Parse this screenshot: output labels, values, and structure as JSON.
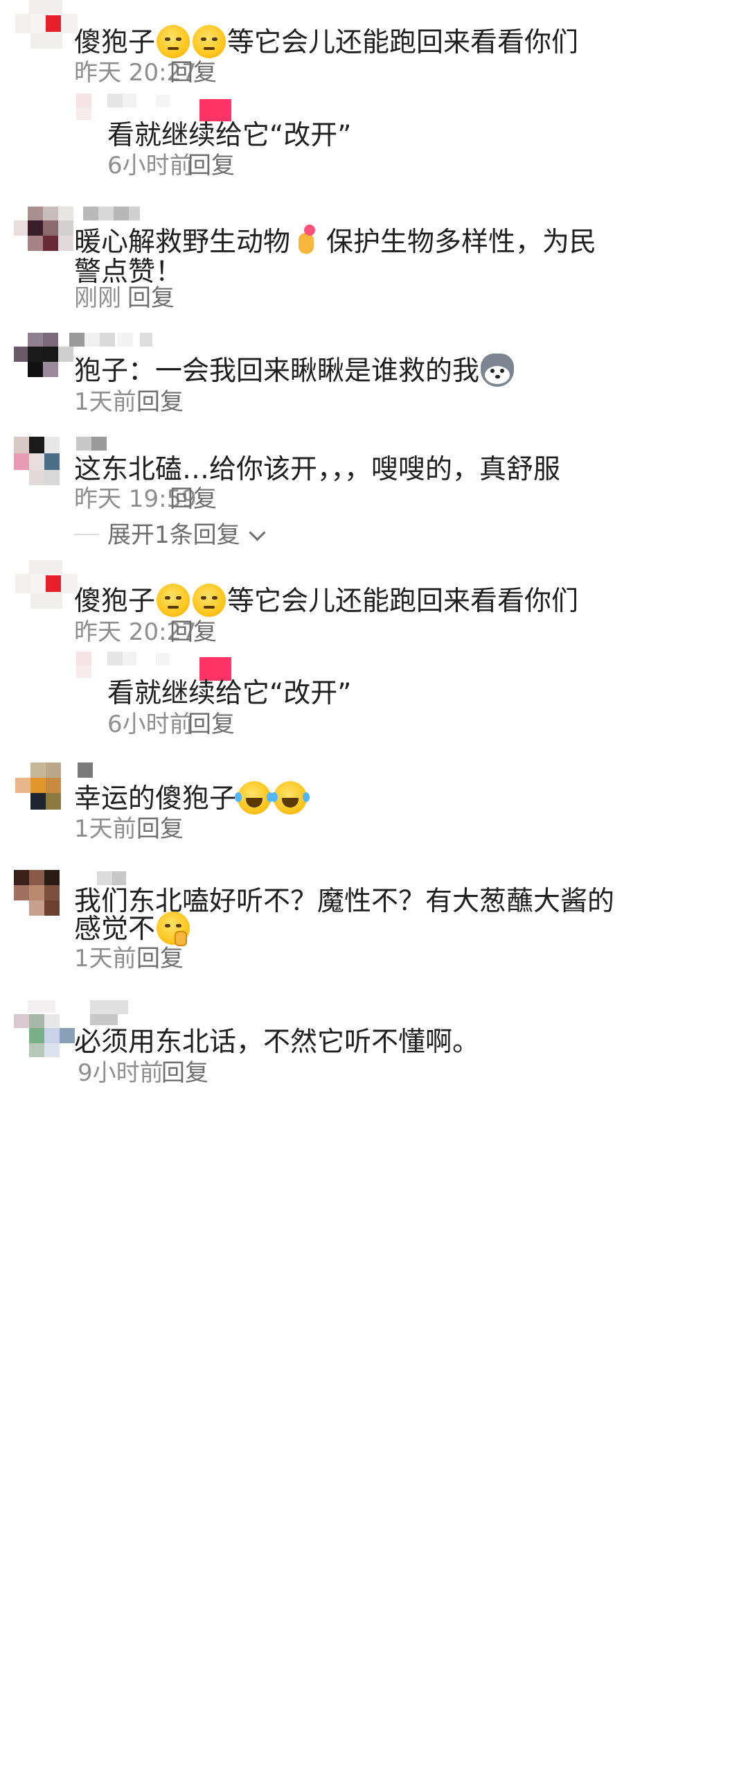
{
  "comments": [
    {
      "text_before": "傻狍子",
      "emojis": [
        "smirk-face-icon",
        "smirk-face-icon"
      ],
      "text_after": "等它会儿还能跑回来看看你们",
      "time": "昨天 20:27",
      "reply": "回复"
    },
    {
      "reply_text": "看就继续给它“改开”",
      "time": "6小时前",
      "reply": "回复"
    },
    {
      "text_line1_before": "暖心解救野生动物",
      "emoji": "heart-hand-icon",
      "text_line1_after": "保护生物多样性，为民",
      "text_line2": "警点赞！",
      "time": "刚刚",
      "reply": "回复"
    },
    {
      "text": "狍子：一会我回来瞅瞅是谁救的我",
      "emoji": "husky-face-icon",
      "time": "1天前",
      "reply": "回复"
    },
    {
      "text": "这东北磕…给你该开，，，嗖嗖的，真舒服",
      "time": "昨天 19:59",
      "reply": "回复",
      "expand": "展开1条回复"
    },
    {
      "text_before": "傻狍子",
      "emojis": [
        "smirk-face-icon",
        "smirk-face-icon"
      ],
      "text_after": "等它会儿还能跑回来看看你们",
      "time": "昨天 20:27",
      "reply": "回复"
    },
    {
      "reply_text": "看就继续给它“改开”",
      "time": "6小时前",
      "reply": "回复"
    },
    {
      "text": "幸运的傻狍子",
      "emojis": [
        "laughing-tears-icon",
        "laughing-tears-icon"
      ],
      "time": "1天前",
      "reply": "回复"
    },
    {
      "text_line1": "我们东北嗑好听不？魔性不？有大葱蘸大酱的",
      "text_line2": "感觉不",
      "emoji": "shushing-face-icon",
      "time": "1天前",
      "reply": "回复"
    },
    {
      "text": "必须用东北话，不然它听不懂啊。",
      "time": "9小时前",
      "reply": "回复"
    }
  ],
  "colors": {
    "text": "#1f1f1f",
    "meta": "#8e8e8e",
    "reply": "#6e6e6e",
    "pink_block": "#ff3366"
  }
}
